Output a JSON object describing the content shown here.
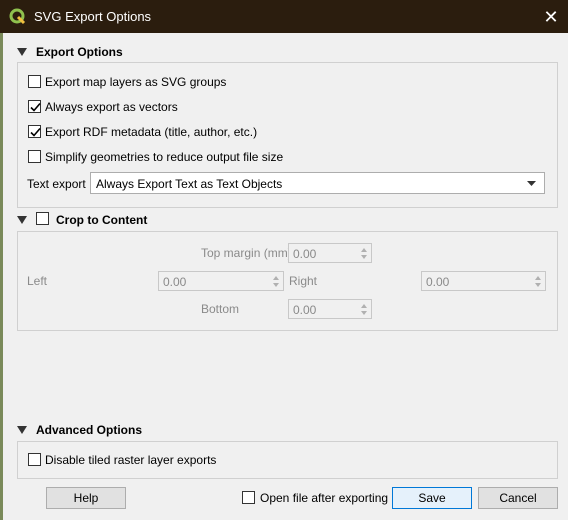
{
  "window": {
    "title": "SVG Export Options",
    "close_icon": "close-icon"
  },
  "export_options": {
    "header": "Export Options",
    "checkboxes": [
      {
        "label": "Export map layers as SVG groups",
        "checked": false
      },
      {
        "label": "Always export as vectors",
        "checked": true
      },
      {
        "label": "Export RDF metadata (title, author, etc.)",
        "checked": true
      },
      {
        "label": "Simplify geometries to reduce output file size",
        "checked": false
      }
    ],
    "text_export_label": "Text export",
    "text_export_value": "Always Export Text as Text Objects"
  },
  "crop": {
    "header": "Crop to Content",
    "checked": false,
    "top_label": "Top margin (mm)",
    "top_value": "0.00",
    "left_label": "Left",
    "left_value": "0.00",
    "right_label": "Right",
    "right_value": "0.00",
    "bottom_label": "Bottom",
    "bottom_value": "0.00"
  },
  "advanced": {
    "header": "Advanced Options",
    "checkbox_label": "Disable tiled raster layer exports",
    "checked": false
  },
  "footer": {
    "help": "Help",
    "open_after_label": "Open file after exporting",
    "open_after_checked": false,
    "save": "Save",
    "cancel": "Cancel"
  },
  "colors": {
    "titlebar": "#2b1d0e",
    "accent": "#0078d7",
    "qgis_green": "#8fc14e"
  }
}
